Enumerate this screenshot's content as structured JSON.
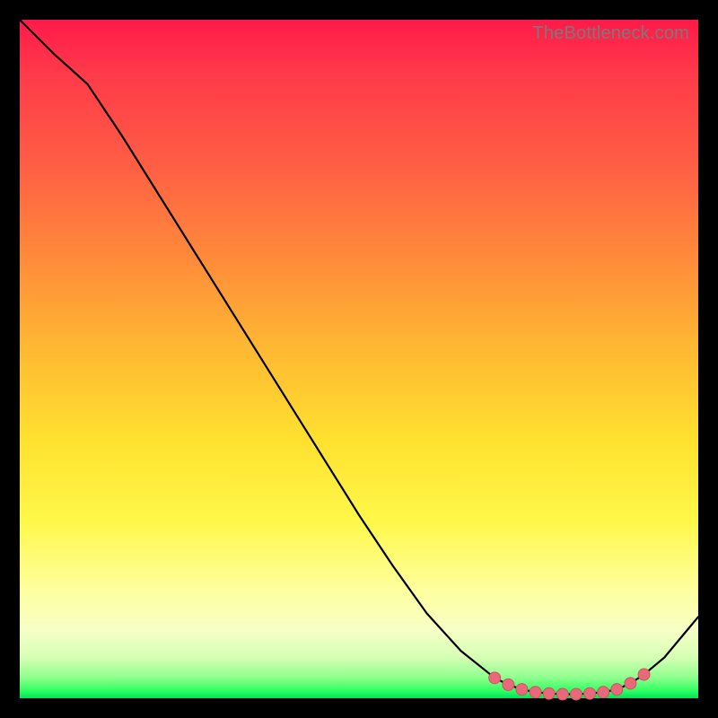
{
  "watermark": "TheBottleneck.com",
  "colors": {
    "curve_stroke": "#000000",
    "marker_fill": "#e86a7a",
    "marker_stroke": "#d64f63"
  },
  "chart_data": {
    "type": "line",
    "title": "",
    "xlabel": "",
    "ylabel": "",
    "xlim": [
      0,
      100
    ],
    "ylim": [
      0,
      100
    ],
    "x": [
      0,
      5,
      10,
      15,
      20,
      25,
      30,
      35,
      40,
      45,
      50,
      55,
      60,
      65,
      70,
      72,
      74,
      76,
      78,
      80,
      82,
      84,
      86,
      88,
      90,
      92,
      95,
      100
    ],
    "y": [
      100,
      95,
      90.5,
      83,
      75,
      67,
      59,
      51,
      43,
      35,
      27,
      19.5,
      12.5,
      7,
      3,
      2,
      1.3,
      0.9,
      0.7,
      0.6,
      0.6,
      0.7,
      0.9,
      1.3,
      2.2,
      3.5,
      6,
      12
    ],
    "markers": {
      "x": [
        70,
        72,
        74,
        76,
        78,
        80,
        82,
        84,
        86,
        88,
        90,
        92
      ],
      "y": [
        3,
        2,
        1.3,
        0.9,
        0.7,
        0.6,
        0.6,
        0.7,
        0.9,
        1.3,
        2.2,
        3.5
      ]
    }
  }
}
